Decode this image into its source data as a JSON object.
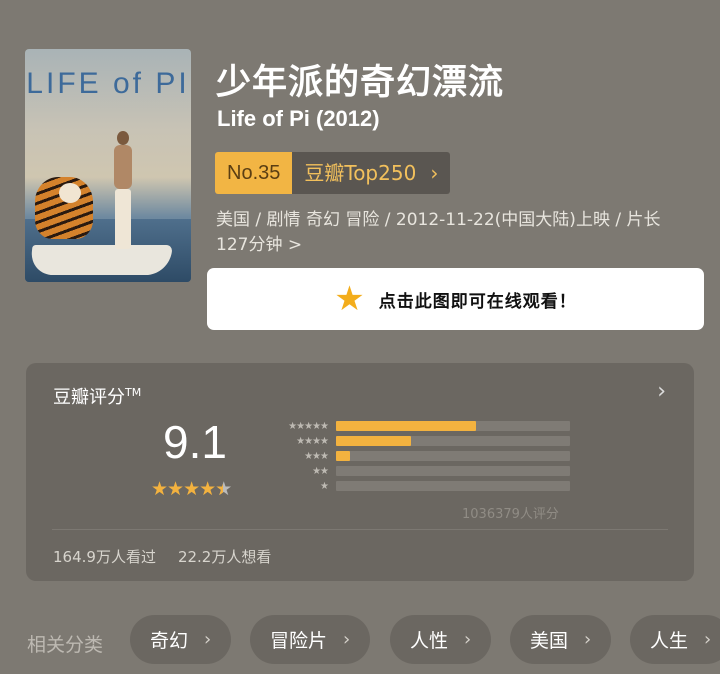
{
  "movie": {
    "title_cn": "少年派的奇幻漂流",
    "title_en": "Life of Pi (2012)",
    "poster_title": "LIFE of PI"
  },
  "rank": {
    "number": "No.35",
    "list_label": "豆瓣Top250"
  },
  "meta": "美国 / 剧情 奇幻 冒险 / 2012-11-22(中国大陆)上映 / 片长 127分钟 >",
  "watch_button": {
    "label": "点击此图即可在线观看！",
    "icon": "star-icon"
  },
  "rating": {
    "title": "豆瓣评分",
    "tm": "TM",
    "score": "9.1",
    "star_value": 4.5,
    "distribution": [
      {
        "stars": "★★★★★",
        "fraction": 0.6
      },
      {
        "stars": "★★★★",
        "fraction": 0.32
      },
      {
        "stars": "★★★",
        "fraction": 0.06
      },
      {
        "stars": "★★",
        "fraction": 0.0
      },
      {
        "stars": "★",
        "fraction": 0.0
      }
    ],
    "vote_count": "1036379人评分",
    "watched": "164.9万人看过",
    "wish": "22.2万人想看"
  },
  "related": {
    "label": "相关分类",
    "chips": [
      "奇幻",
      "冒险片",
      "人性",
      "美国",
      "人生"
    ]
  },
  "colors": {
    "background": "#7d7972",
    "accent": "#f3b23f",
    "card": "#6b6761"
  }
}
